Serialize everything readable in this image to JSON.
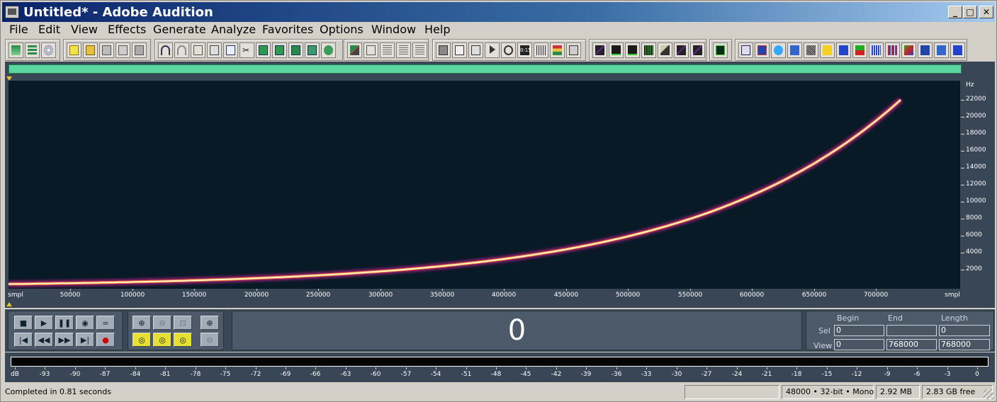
{
  "window": {
    "title": "Untitled* - Adobe Audition",
    "controls": {
      "minimize": "_",
      "maximize": "□",
      "close": "✕"
    }
  },
  "menu": [
    "File",
    "Edit",
    "View",
    "Effects",
    "Generate",
    "Analyze",
    "Favorites",
    "Options",
    "Window",
    "Help"
  ],
  "spectrogram": {
    "hz_unit": "Hz",
    "hz_labels": [
      "22000",
      "20000",
      "18000",
      "16000",
      "14000",
      "12000",
      "10000",
      "8000",
      "6000",
      "4000",
      "2000"
    ],
    "time_unit": "smpl",
    "time_labels": [
      "50000",
      "100000",
      "150000",
      "200000",
      "250000",
      "300000",
      "350000",
      "400000",
      "450000",
      "500000",
      "550000",
      "600000",
      "650000",
      "700000"
    ],
    "sweep_end_sample": 720000,
    "sweep_end_hz": 22000
  },
  "transport": {
    "row1": [
      "stop-icon",
      "play-icon",
      "pause-icon",
      "play-to-end-icon",
      "loop-icon"
    ],
    "row2": [
      "go-to-start-icon",
      "rewind-icon",
      "fast-forward-icon",
      "go-to-end-icon",
      "record-icon"
    ]
  },
  "zoom": {
    "row1": [
      "zoom-in-icon",
      "zoom-out-icon",
      "zoom-full-icon"
    ],
    "row2": [
      "zoom-selection-icon",
      "zoom-left-icon",
      "zoom-right-icon"
    ],
    "vertical": [
      "zoom-in-vertical-icon",
      "zoom-out-vertical-icon"
    ]
  },
  "clock": {
    "value": "0"
  },
  "selection": {
    "headers": {
      "begin": "Begin",
      "end": "End",
      "length": "Length"
    },
    "sel": {
      "label": "Sel",
      "begin": "0",
      "end": "",
      "length": "0"
    },
    "view": {
      "label": "View",
      "begin": "0",
      "end": "768000",
      "length": "768000"
    }
  },
  "meter": {
    "labels": [
      "dB",
      "-93",
      "-90",
      "-87",
      "-84",
      "-81",
      "-78",
      "-75",
      "-72",
      "-69",
      "-66",
      "-63",
      "-60",
      "-57",
      "-54",
      "-51",
      "-48",
      "-45",
      "-42",
      "-39",
      "-36",
      "-33",
      "-30",
      "-27",
      "-24",
      "-21",
      "-18",
      "-15",
      "-12",
      "-9",
      "-6",
      "-3",
      "0"
    ]
  },
  "status": {
    "message": "Completed in 0.81 seconds",
    "format": "48000 • 32-bit • Mono",
    "size": "2.92 MB",
    "free": "2.83 GB free"
  },
  "colors": {
    "accent": "#5ad6a0",
    "spectrogram_bg": "#081a26",
    "panel": "#394655",
    "sweep": "#fff6c8"
  }
}
